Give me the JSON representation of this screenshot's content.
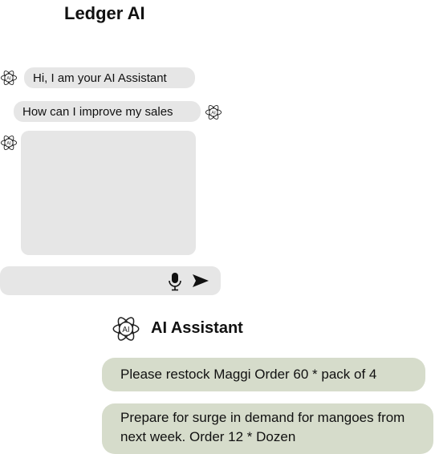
{
  "app": {
    "title": "Ledger AI"
  },
  "chat": {
    "greeting": "Hi, I am your AI Assistant",
    "user_question": "How can I improve my sales",
    "response_text": "",
    "input_value": "",
    "icons": {
      "ai": "ai-atom-icon",
      "mic": "microphone-icon",
      "send": "send-icon"
    }
  },
  "assistant": {
    "title": "AI Assistant",
    "suggestions": [
      "Please restock Maggi Order 60 * pack of 4",
      "Prepare for surge in demand for mangoes from next week. Order 12 * Dozen"
    ]
  },
  "colors": {
    "bubble": "#e6e6e6",
    "suggestion_card": "#d6dccb",
    "text": "#111111"
  }
}
